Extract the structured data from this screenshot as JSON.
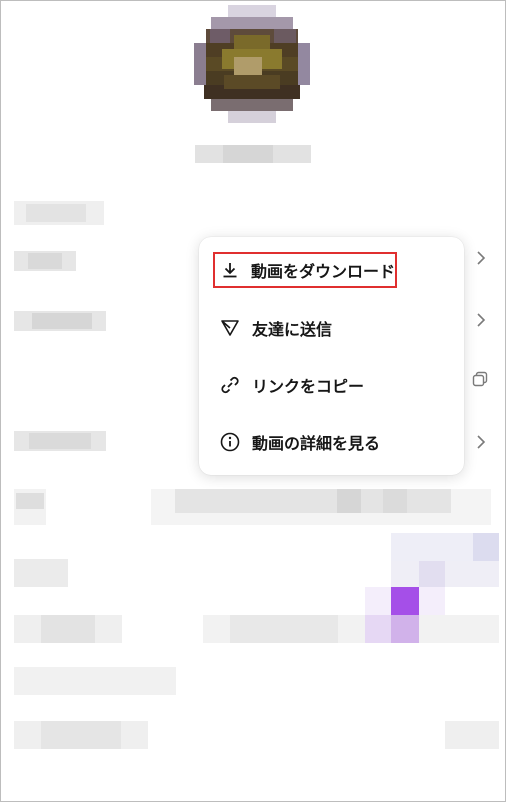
{
  "context_menu": {
    "items": [
      {
        "label": "動画をダウンロード",
        "icon": "download-icon",
        "highlighted": true
      },
      {
        "label": "友達に送信",
        "icon": "send-icon"
      },
      {
        "label": "リンクをコピー",
        "icon": "link-icon"
      },
      {
        "label": "動画の詳細を見る",
        "icon": "info-icon"
      }
    ],
    "highlight_color": "#e02f2f"
  },
  "background": {
    "right_icons": [
      "chevron-right-icon",
      "chevron-right-icon",
      "copy-icon",
      "chevron-right-icon"
    ],
    "accent_color": "#a54fe8"
  }
}
